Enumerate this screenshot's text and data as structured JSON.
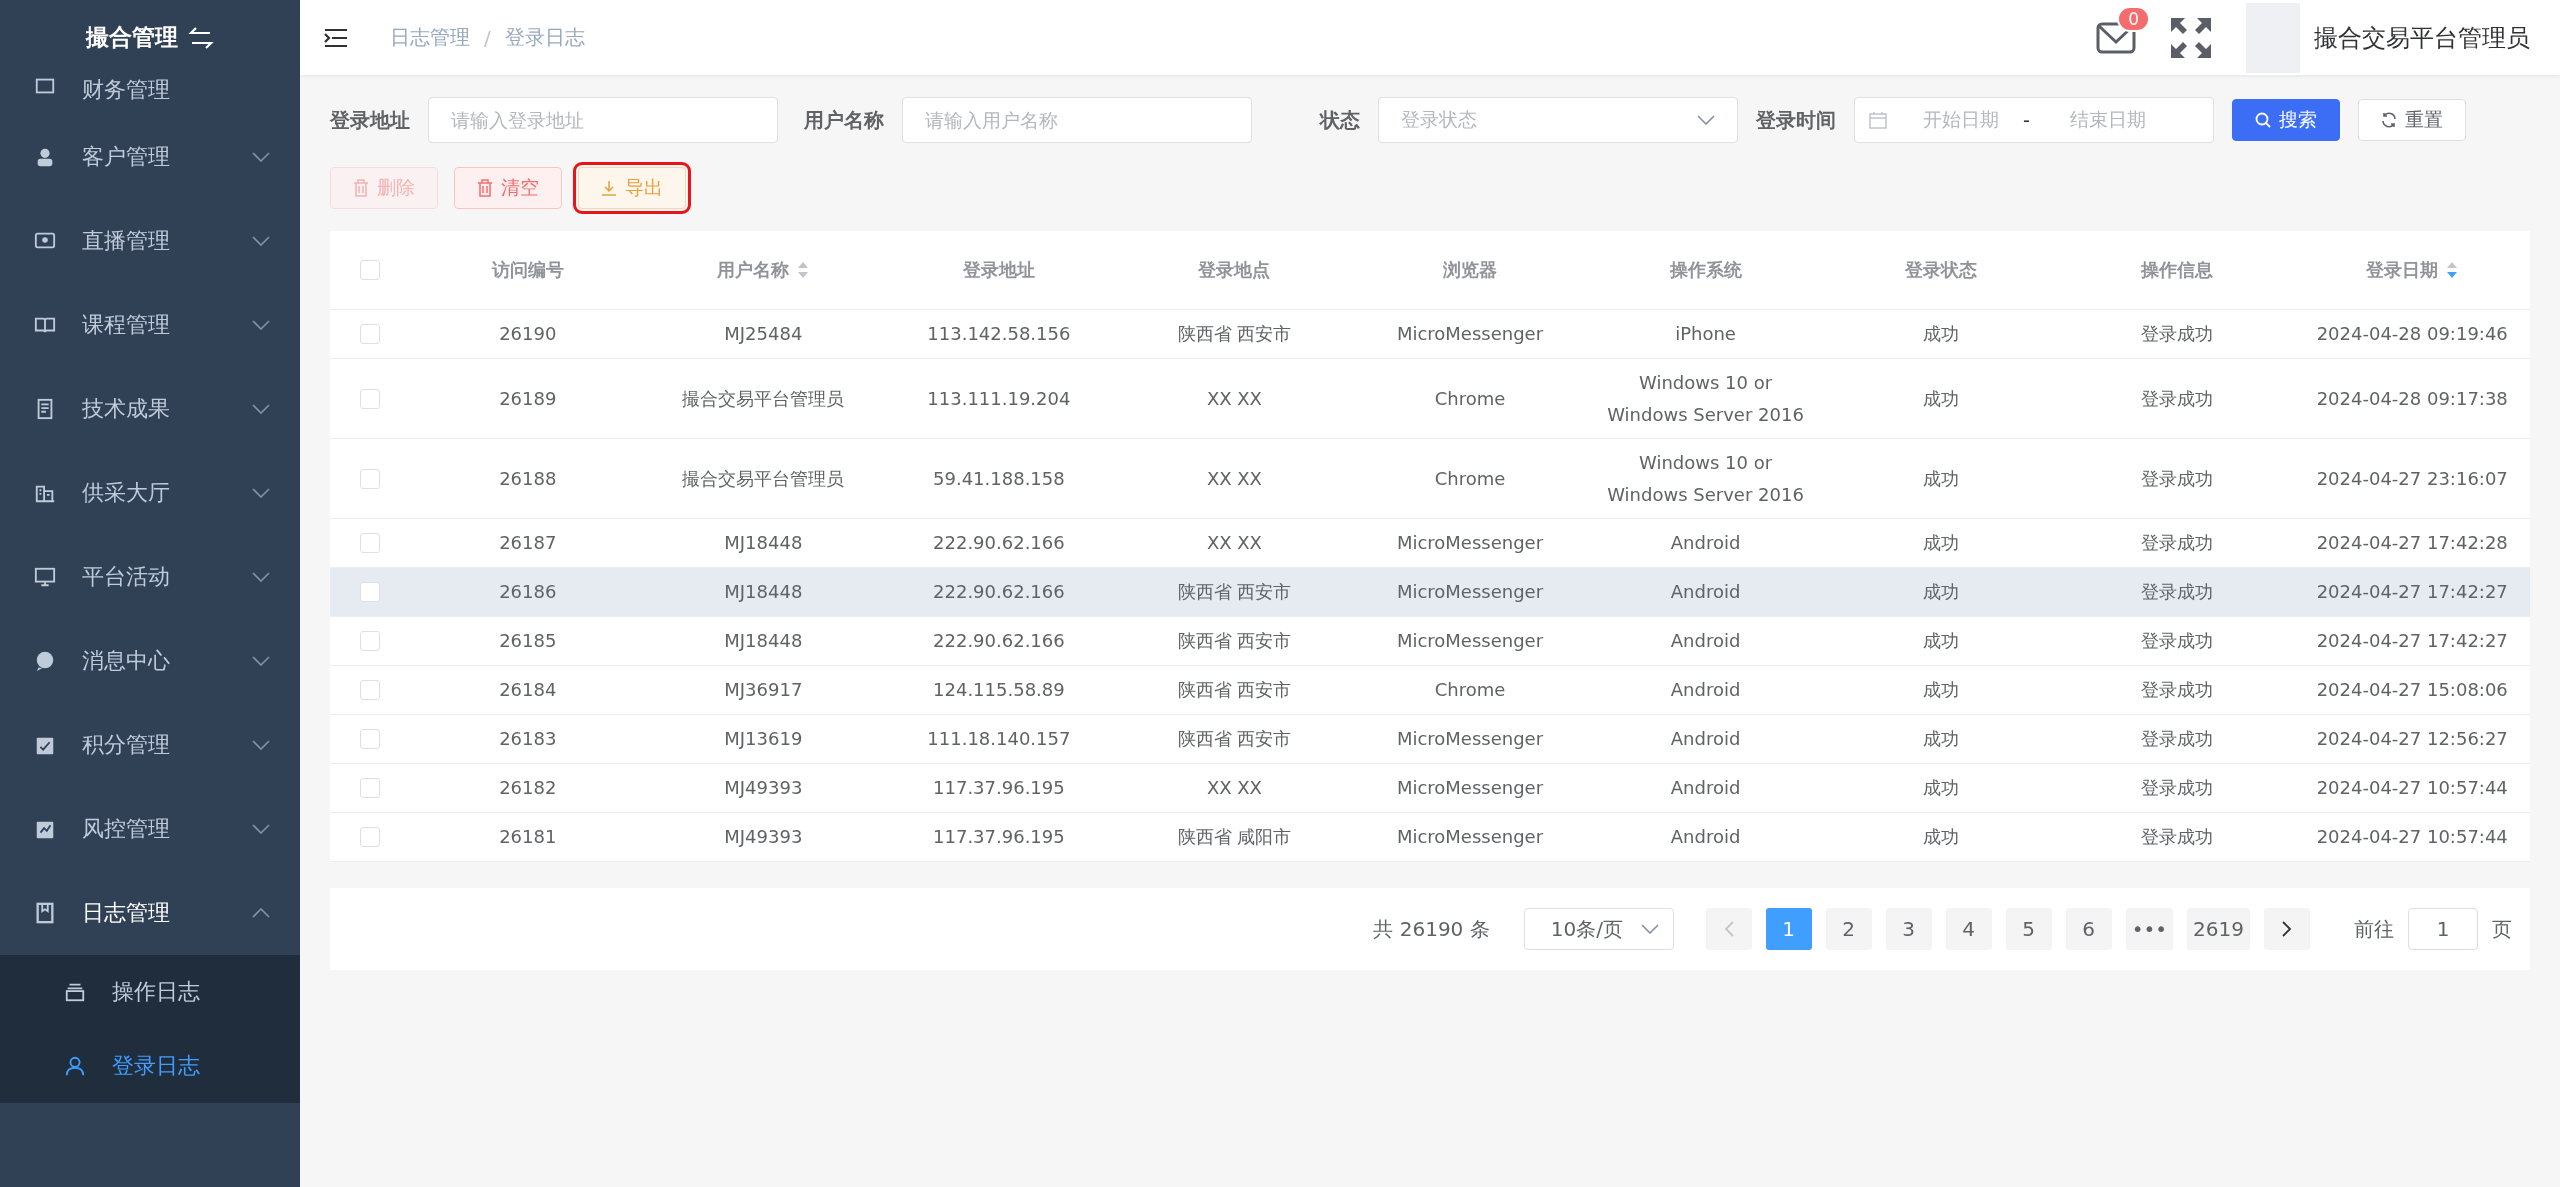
{
  "sidebar": {
    "title": "撮合管理",
    "items": [
      {
        "label": "财务管理",
        "expanded": false
      },
      {
        "label": "客户管理",
        "expanded": false
      },
      {
        "label": "直播管理",
        "expanded": false
      },
      {
        "label": "课程管理",
        "expanded": false
      },
      {
        "label": "技术成果",
        "expanded": false
      },
      {
        "label": "供采大厅",
        "expanded": false
      },
      {
        "label": "平台活动",
        "expanded": false
      },
      {
        "label": "消息中心",
        "expanded": false
      },
      {
        "label": "积分管理",
        "expanded": false
      },
      {
        "label": "风控管理",
        "expanded": false
      },
      {
        "label": "日志管理",
        "expanded": true,
        "children": [
          {
            "label": "操作日志",
            "selected": false
          },
          {
            "label": "登录日志",
            "selected": true
          }
        ]
      }
    ]
  },
  "header": {
    "breadcrumb": [
      "日志管理",
      "登录日志"
    ],
    "breadcrumb_separator": "/",
    "mail_badge": "0",
    "user_name": "撮合交易平台管理员"
  },
  "filters": {
    "fields": [
      {
        "kind": "input",
        "label": "登录地址",
        "placeholder": "请输入登录地址"
      },
      {
        "kind": "input",
        "label": "用户名称",
        "placeholder": "请输入用户名称"
      },
      {
        "kind": "select",
        "label": "状态",
        "placeholder": "登录状态"
      },
      {
        "kind": "daterange",
        "label": "登录时间",
        "placeholder": "开始日期",
        "placeholder_end": "结束日期",
        "separator": "-"
      }
    ],
    "search_button": "搜索",
    "reset_button": "重置"
  },
  "actions": [
    {
      "kind": "delete",
      "label": "删除",
      "disabled": true,
      "highlighted": false
    },
    {
      "kind": "clear",
      "label": "清空",
      "disabled": false,
      "highlighted": false
    },
    {
      "kind": "export",
      "label": "导出",
      "disabled": false,
      "highlighted": true
    }
  ],
  "table": {
    "columns": [
      {
        "label": "访问编号"
      },
      {
        "label": "用户名称",
        "sorted_desc": false
      },
      {
        "label": "登录地址"
      },
      {
        "label": "登录地点"
      },
      {
        "label": "浏览器"
      },
      {
        "label": "操作系统"
      },
      {
        "label": "登录状态"
      },
      {
        "label": "操作信息"
      },
      {
        "label": "登录日期",
        "sorted_desc": true
      }
    ],
    "header_checked": false,
    "rows": [
      {
        "checked": false,
        "hovered": false,
        "cells": [
          "26190",
          "MJ25484",
          "113.142.58.156",
          "陕西省 西安市",
          "MicroMessenger",
          "iPhone",
          "成功",
          "登录成功",
          "2024-04-28 09:19:46"
        ]
      },
      {
        "checked": false,
        "hovered": false,
        "cells": [
          "26189",
          "撮合交易平台管理员",
          "113.111.19.204",
          "XX XX",
          "Chrome",
          "Windows 10 or Windows Server 2016",
          "成功",
          "登录成功",
          "2024-04-28 09:17:38"
        ]
      },
      {
        "checked": false,
        "hovered": false,
        "cells": [
          "26188",
          "撮合交易平台管理员",
          "59.41.188.158",
          "XX XX",
          "Chrome",
          "Windows 10 or Windows Server 2016",
          "成功",
          "登录成功",
          "2024-04-27 23:16:07"
        ]
      },
      {
        "checked": false,
        "hovered": false,
        "cells": [
          "26187",
          "MJ18448",
          "222.90.62.166",
          "XX XX",
          "MicroMessenger",
          "Android",
          "成功",
          "登录成功",
          "2024-04-27 17:42:28"
        ]
      },
      {
        "checked": false,
        "hovered": true,
        "cells": [
          "26186",
          "MJ18448",
          "222.90.62.166",
          "陕西省 西安市",
          "MicroMessenger",
          "Android",
          "成功",
          "登录成功",
          "2024-04-27 17:42:27"
        ]
      },
      {
        "checked": false,
        "hovered": false,
        "cells": [
          "26185",
          "MJ18448",
          "222.90.62.166",
          "陕西省 西安市",
          "MicroMessenger",
          "Android",
          "成功",
          "登录成功",
          "2024-04-27 17:42:27"
        ]
      },
      {
        "checked": false,
        "hovered": false,
        "cells": [
          "26184",
          "MJ36917",
          "124.115.58.89",
          "陕西省 西安市",
          "Chrome",
          "Android",
          "成功",
          "登录成功",
          "2024-04-27 15:08:06"
        ]
      },
      {
        "checked": false,
        "hovered": false,
        "cells": [
          "26183",
          "MJ13619",
          "111.18.140.157",
          "陕西省 西安市",
          "MicroMessenger",
          "Android",
          "成功",
          "登录成功",
          "2024-04-27 12:56:27"
        ]
      },
      {
        "checked": false,
        "hovered": false,
        "cells": [
          "26182",
          "MJ49393",
          "117.37.96.195",
          "XX XX",
          "MicroMessenger",
          "Android",
          "成功",
          "登录成功",
          "2024-04-27 10:57:44"
        ]
      },
      {
        "checked": false,
        "hovered": false,
        "cells": [
          "26181",
          "MJ49393",
          "117.37.96.195",
          "陕西省 咸阳市",
          "MicroMessenger",
          "Android",
          "成功",
          "登录成功",
          "2024-04-27 10:57:44"
        ]
      }
    ]
  },
  "pagination": {
    "total": "共 26190 条",
    "page_size": "10条/页",
    "prev_disabled": true,
    "pages": [
      {
        "label": "1",
        "selected": true
      },
      {
        "label": "2",
        "selected": false
      },
      {
        "label": "3",
        "selected": false
      },
      {
        "label": "4",
        "selected": false
      },
      {
        "label": "5",
        "selected": false
      },
      {
        "label": "6",
        "selected": false
      },
      {
        "label": "•••",
        "selected": false
      },
      {
        "label": "2619",
        "selected": false
      }
    ],
    "goto_label": "前往",
    "goto_value": "1",
    "page_unit": "页"
  }
}
